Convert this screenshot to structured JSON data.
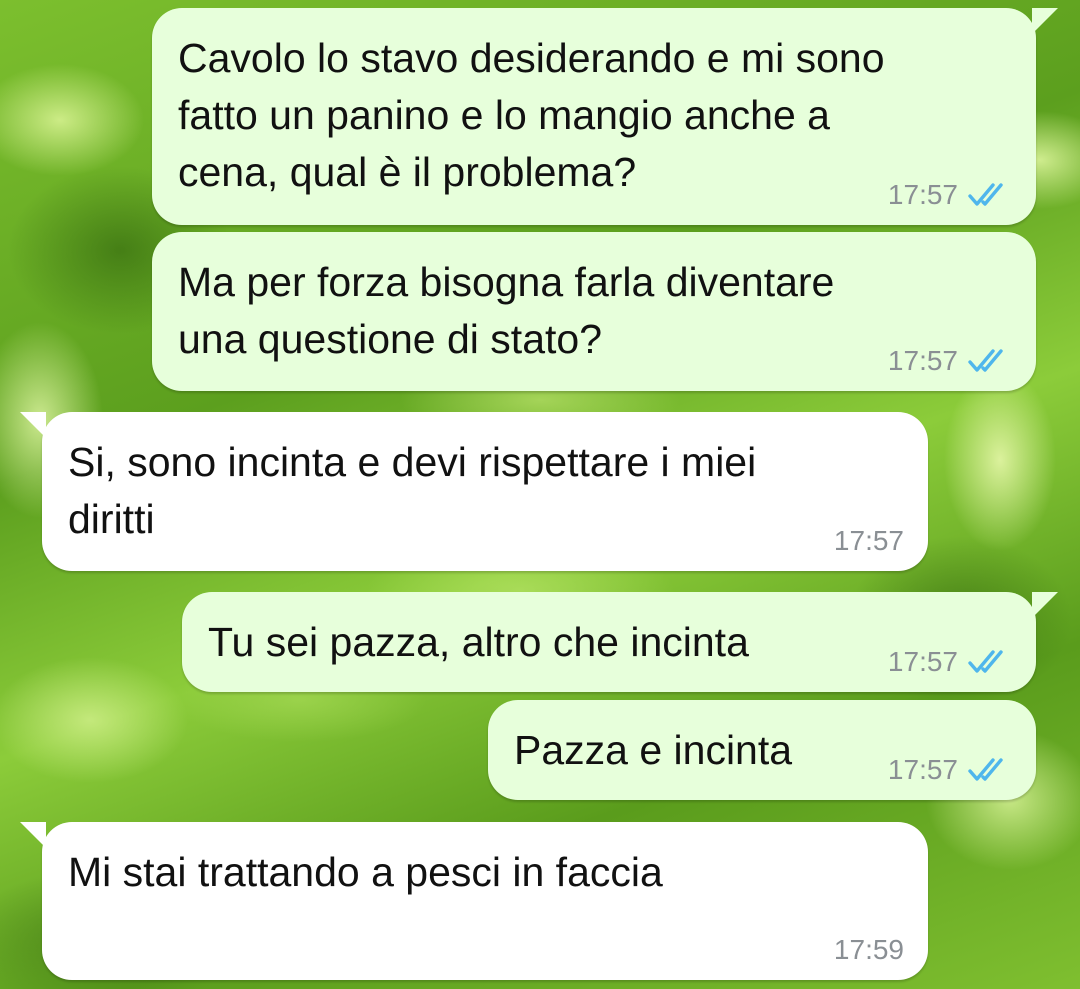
{
  "chat": {
    "messages": [
      {
        "direction": "outgoing",
        "text": "Cavolo lo stavo desiderando e mi sono\nfatto un panino e lo mangio anche a\ncena, qual è il problema?",
        "time": "17:57",
        "status": "read",
        "status_icon": "double-check-icon"
      },
      {
        "direction": "outgoing",
        "text": "Ma per forza bisogna farla diventare\nuna questione di stato?",
        "time": "17:57",
        "status": "read",
        "status_icon": "double-check-icon"
      },
      {
        "direction": "incoming",
        "text": "Si, sono incinta e devi rispettare i miei\ndiritti",
        "time": "17:57"
      },
      {
        "direction": "outgoing",
        "text": "Tu sei pazza, altro che incinta",
        "time": "17:57",
        "status": "read",
        "status_icon": "double-check-icon"
      },
      {
        "direction": "outgoing",
        "text": "Pazza e incinta",
        "time": "17:57",
        "status": "read",
        "status_icon": "double-check-icon"
      },
      {
        "direction": "incoming",
        "text": "Mi stai trattando a pesci in faccia",
        "time": "17:59"
      }
    ]
  },
  "colors": {
    "outgoing_bubble": "#e7ffdb",
    "incoming_bubble": "#ffffff",
    "read_tick": "#4fb6ec",
    "timestamp": "#8a8f94"
  }
}
